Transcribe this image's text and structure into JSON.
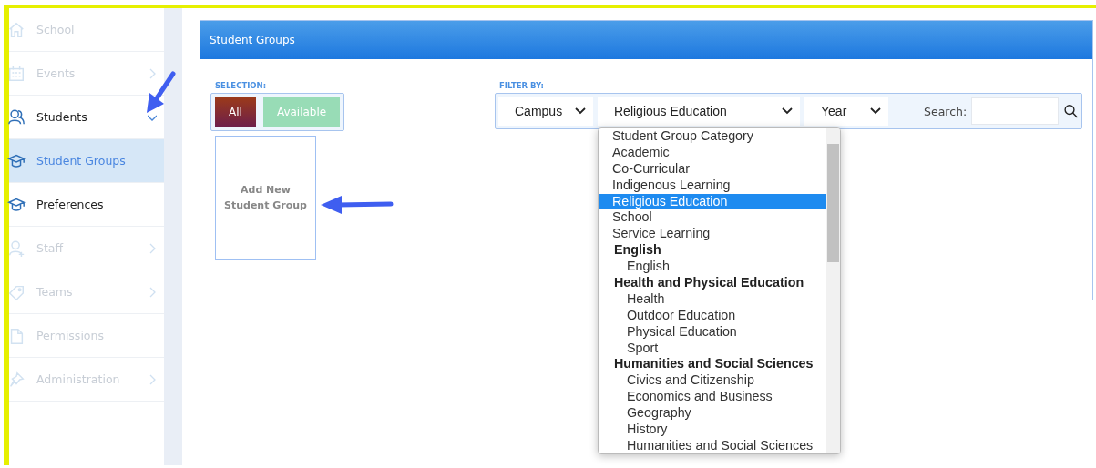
{
  "sidebar": {
    "items": [
      {
        "label": "School",
        "kind": "link",
        "dimmed": true,
        "selected": false
      },
      {
        "label": "Events",
        "kind": "group",
        "dimmed": true,
        "expanded": false,
        "selected": false
      },
      {
        "label": "Students",
        "kind": "group",
        "dimmed": false,
        "expanded": true,
        "selected": false
      },
      {
        "label": "Student Groups",
        "kind": "link",
        "dimmed": false,
        "selected": true
      },
      {
        "label": "Preferences",
        "kind": "link",
        "dimmed": false,
        "selected": false
      },
      {
        "label": "Staff",
        "kind": "group",
        "dimmed": true,
        "expanded": false,
        "selected": false
      },
      {
        "label": "Teams",
        "kind": "group",
        "dimmed": true,
        "expanded": false,
        "selected": false
      },
      {
        "label": "Permissions",
        "kind": "link",
        "dimmed": true,
        "selected": false
      },
      {
        "label": "Administration",
        "kind": "group",
        "dimmed": true,
        "expanded": false,
        "selected": false
      }
    ]
  },
  "panel": {
    "title": "Student Groups",
    "selection": {
      "label": "SELECTION:",
      "buttons": [
        {
          "label": "All",
          "selected": true
        },
        {
          "label": "Available",
          "selected": false
        }
      ]
    },
    "add_card": {
      "label": "Add New Student Group"
    },
    "filter": {
      "label": "FILTER BY:",
      "selects": [
        {
          "value": "Campus",
          "open": false
        },
        {
          "value": "Religious Education",
          "open": true
        },
        {
          "value": "Year",
          "open": false
        }
      ],
      "search_label": "Search:"
    },
    "dropdown": {
      "options": [
        {
          "label": "Student Group Category",
          "kind": "option",
          "selected": false
        },
        {
          "label": "Academic",
          "kind": "option",
          "selected": false
        },
        {
          "label": "Co-Curricular",
          "kind": "option",
          "selected": false
        },
        {
          "label": "Indigenous Learning",
          "kind": "option",
          "selected": false
        },
        {
          "label": "Religious Education",
          "kind": "option",
          "selected": true
        },
        {
          "label": "School",
          "kind": "option",
          "selected": false
        },
        {
          "label": "Service Learning",
          "kind": "option",
          "selected": false
        },
        {
          "label": "English",
          "kind": "group",
          "selected": false
        },
        {
          "label": "English",
          "kind": "suboption",
          "selected": false
        },
        {
          "label": "Health and Physical Education",
          "kind": "group",
          "selected": false
        },
        {
          "label": "Health",
          "kind": "suboption",
          "selected": false
        },
        {
          "label": "Outdoor Education",
          "kind": "suboption",
          "selected": false
        },
        {
          "label": "Physical Education",
          "kind": "suboption",
          "selected": false
        },
        {
          "label": "Sport",
          "kind": "suboption",
          "selected": false
        },
        {
          "label": "Humanities and Social Sciences",
          "kind": "group",
          "selected": false
        },
        {
          "label": "Civics and Citizenship",
          "kind": "suboption",
          "selected": false
        },
        {
          "label": "Economics and Business",
          "kind": "suboption",
          "selected": false
        },
        {
          "label": "Geography",
          "kind": "suboption",
          "selected": false
        },
        {
          "label": "History",
          "kind": "suboption",
          "selected": false
        },
        {
          "label": "Humanities and Social Sciences",
          "kind": "suboption",
          "selected": false
        }
      ]
    }
  }
}
